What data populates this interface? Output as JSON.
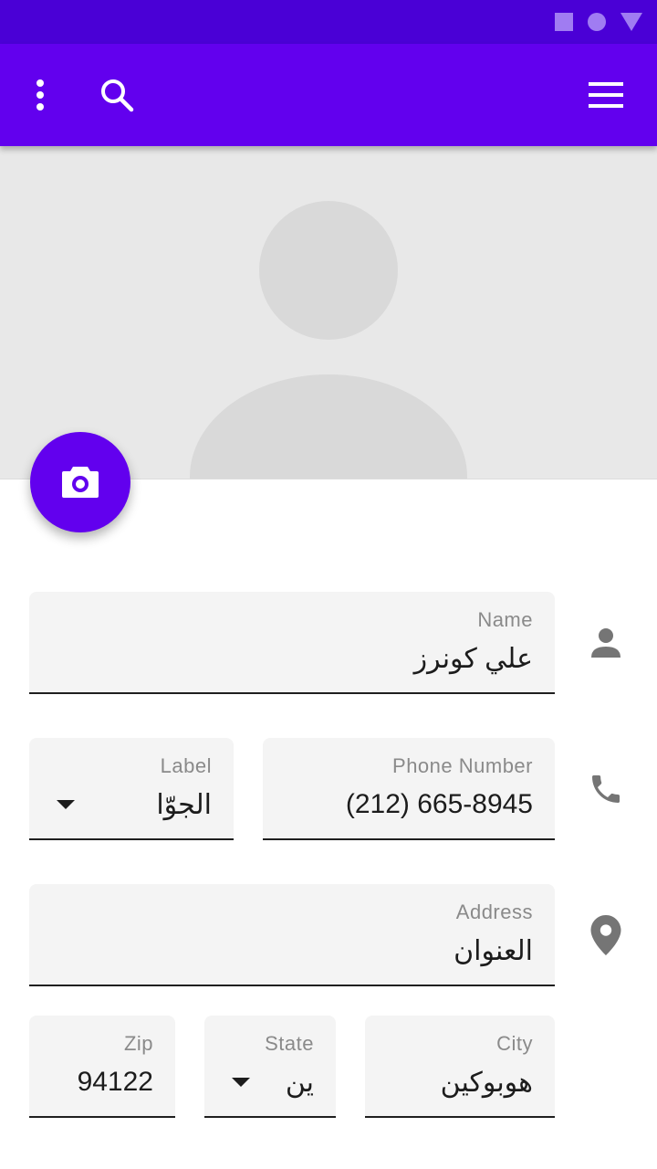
{
  "colors": {
    "primary": "#6200ee",
    "status_bar": "#4a00d6",
    "hero_background": "#e8e8e8",
    "field_background": "#f4f4f4",
    "icon_gray": "#757575"
  },
  "app_bar": {
    "more_icon": "more-vert-icon",
    "search_icon": "search-icon",
    "menu_icon": "menu-icon"
  },
  "fab": {
    "icon": "camera-icon"
  },
  "form": {
    "name": {
      "label": "Name",
      "value": "علي كونرز"
    },
    "phone": {
      "label": "Phone Number",
      "value": "(212) 665-8945"
    },
    "phone_label": {
      "label": "Label",
      "value": "الجوّا"
    },
    "address": {
      "label": "Address",
      "value": "العنوان"
    },
    "city": {
      "label": "City",
      "value": "هوبوكين"
    },
    "state": {
      "label": "State",
      "value": "ين"
    },
    "zip": {
      "label": "Zip",
      "value": "94122"
    }
  }
}
